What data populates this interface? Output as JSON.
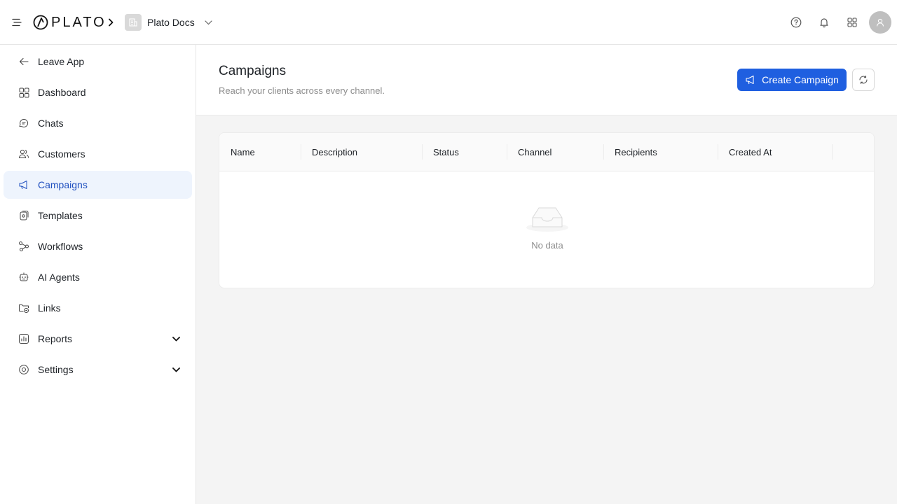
{
  "header": {
    "logo_text": "PLATO",
    "workspace_name": "Plato Docs",
    "icons": [
      "menu-fold-icon",
      "help-icon",
      "bell-icon",
      "apps-grid-icon",
      "user-avatar-icon"
    ]
  },
  "sidebar": {
    "items": [
      {
        "label": "Leave App",
        "icon": "arrow-left-icon"
      },
      {
        "label": "Dashboard",
        "icon": "dashboard-icon"
      },
      {
        "label": "Chats",
        "icon": "chat-icon"
      },
      {
        "label": "Customers",
        "icon": "users-icon"
      },
      {
        "label": "Campaigns",
        "icon": "megaphone-icon",
        "active": true
      },
      {
        "label": "Templates",
        "icon": "templates-icon"
      },
      {
        "label": "Workflows",
        "icon": "workflow-icon"
      },
      {
        "label": "AI Agents",
        "icon": "ai-agent-icon"
      },
      {
        "label": "Links",
        "icon": "link-folder-icon"
      },
      {
        "label": "Reports",
        "icon": "report-icon",
        "expandable": true
      },
      {
        "label": "Settings",
        "icon": "settings-icon",
        "expandable": true
      }
    ]
  },
  "page": {
    "title": "Campaigns",
    "subtitle": "Reach your clients across every channel.",
    "create_label": "Create Campaign"
  },
  "table": {
    "columns": [
      "Name",
      "Description",
      "Status",
      "Channel",
      "Recipients",
      "Created At"
    ],
    "empty_text": "No data"
  },
  "colors": {
    "primary": "#1f5fe0",
    "active_bg": "#eef4fd",
    "active_text": "#1f4fbf"
  }
}
